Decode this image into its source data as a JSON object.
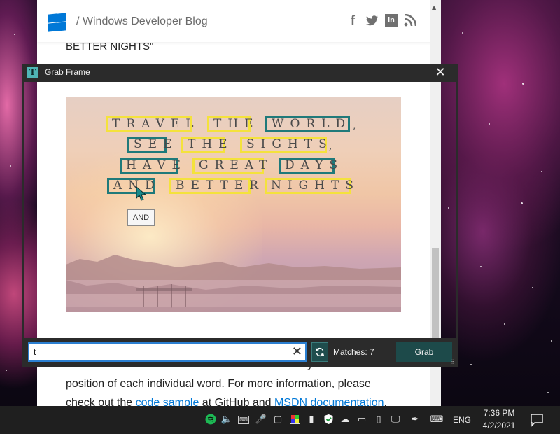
{
  "browser": {
    "blog_title": "/ Windows Developer Blog",
    "social": {
      "facebook": "f",
      "linkedin": "in"
    },
    "prev_heading_tail": "BETTER NIGHTS\"",
    "body_lines": [
      "OcrResult can be also used to retrieve text line by line or find",
      "position of each individual word. For more information, please"
    ],
    "body_line3_pre": "check out the ",
    "body_line3_link1": "code sample",
    "body_line3_mid": " at GitHub and ",
    "body_line3_link2": "MSDN documentation",
    "body_line3_post": "."
  },
  "grab_frame": {
    "title": "Grab Frame",
    "search_value": "t",
    "matches_label": "Matches: 7",
    "grab_label": "Grab",
    "icons": {
      "app": "T",
      "close": "close-icon",
      "clear": "clear-icon",
      "refresh": "refresh-icon"
    }
  },
  "banner": {
    "words": [
      {
        "text": "TRAVEL",
        "highlight": "yellow"
      },
      {
        "text": "THE",
        "highlight": "yellow"
      },
      {
        "text": "WORLD",
        "highlight": "teal"
      },
      {
        "text": "SEE",
        "highlight": "teal"
      },
      {
        "text": "THE",
        "highlight": "yellow"
      },
      {
        "text": "SIGHTS",
        "highlight": "yellow"
      },
      {
        "text": "HAVE",
        "highlight": "teal"
      },
      {
        "text": "GREAT",
        "highlight": "yellow"
      },
      {
        "text": "DAYS",
        "highlight": "teal"
      },
      {
        "text": "AND",
        "highlight": "teal"
      },
      {
        "text": "BETTER",
        "highlight": "yellow"
      },
      {
        "text": "NIGHTS",
        "highlight": "yellow"
      }
    ],
    "punctuation": [
      ",",
      ","
    ],
    "tooltip": "AND",
    "colors": {
      "yellow": "#f4e23c",
      "teal": "#1f7a7a"
    }
  },
  "taskbar": {
    "lang": "ENG",
    "time": "7:36 PM",
    "date": "4/2/2021",
    "tray_icons": [
      "spotify-icon",
      "volume-icon",
      "keyboard-icon",
      "microphone-icon",
      "document-icon",
      "color-picker-icon",
      "microphone-mute-icon",
      "security-shield-icon",
      "onedrive-icon",
      "tablet-icon",
      "usb-icon",
      "network-icon",
      "pen-icon",
      "touch-keyboard-icon"
    ],
    "notification": "notification-icon"
  },
  "colors": {
    "accent": "#0078d7",
    "grab_button": "#1d4a4a",
    "frame": "#2b2b2b"
  }
}
